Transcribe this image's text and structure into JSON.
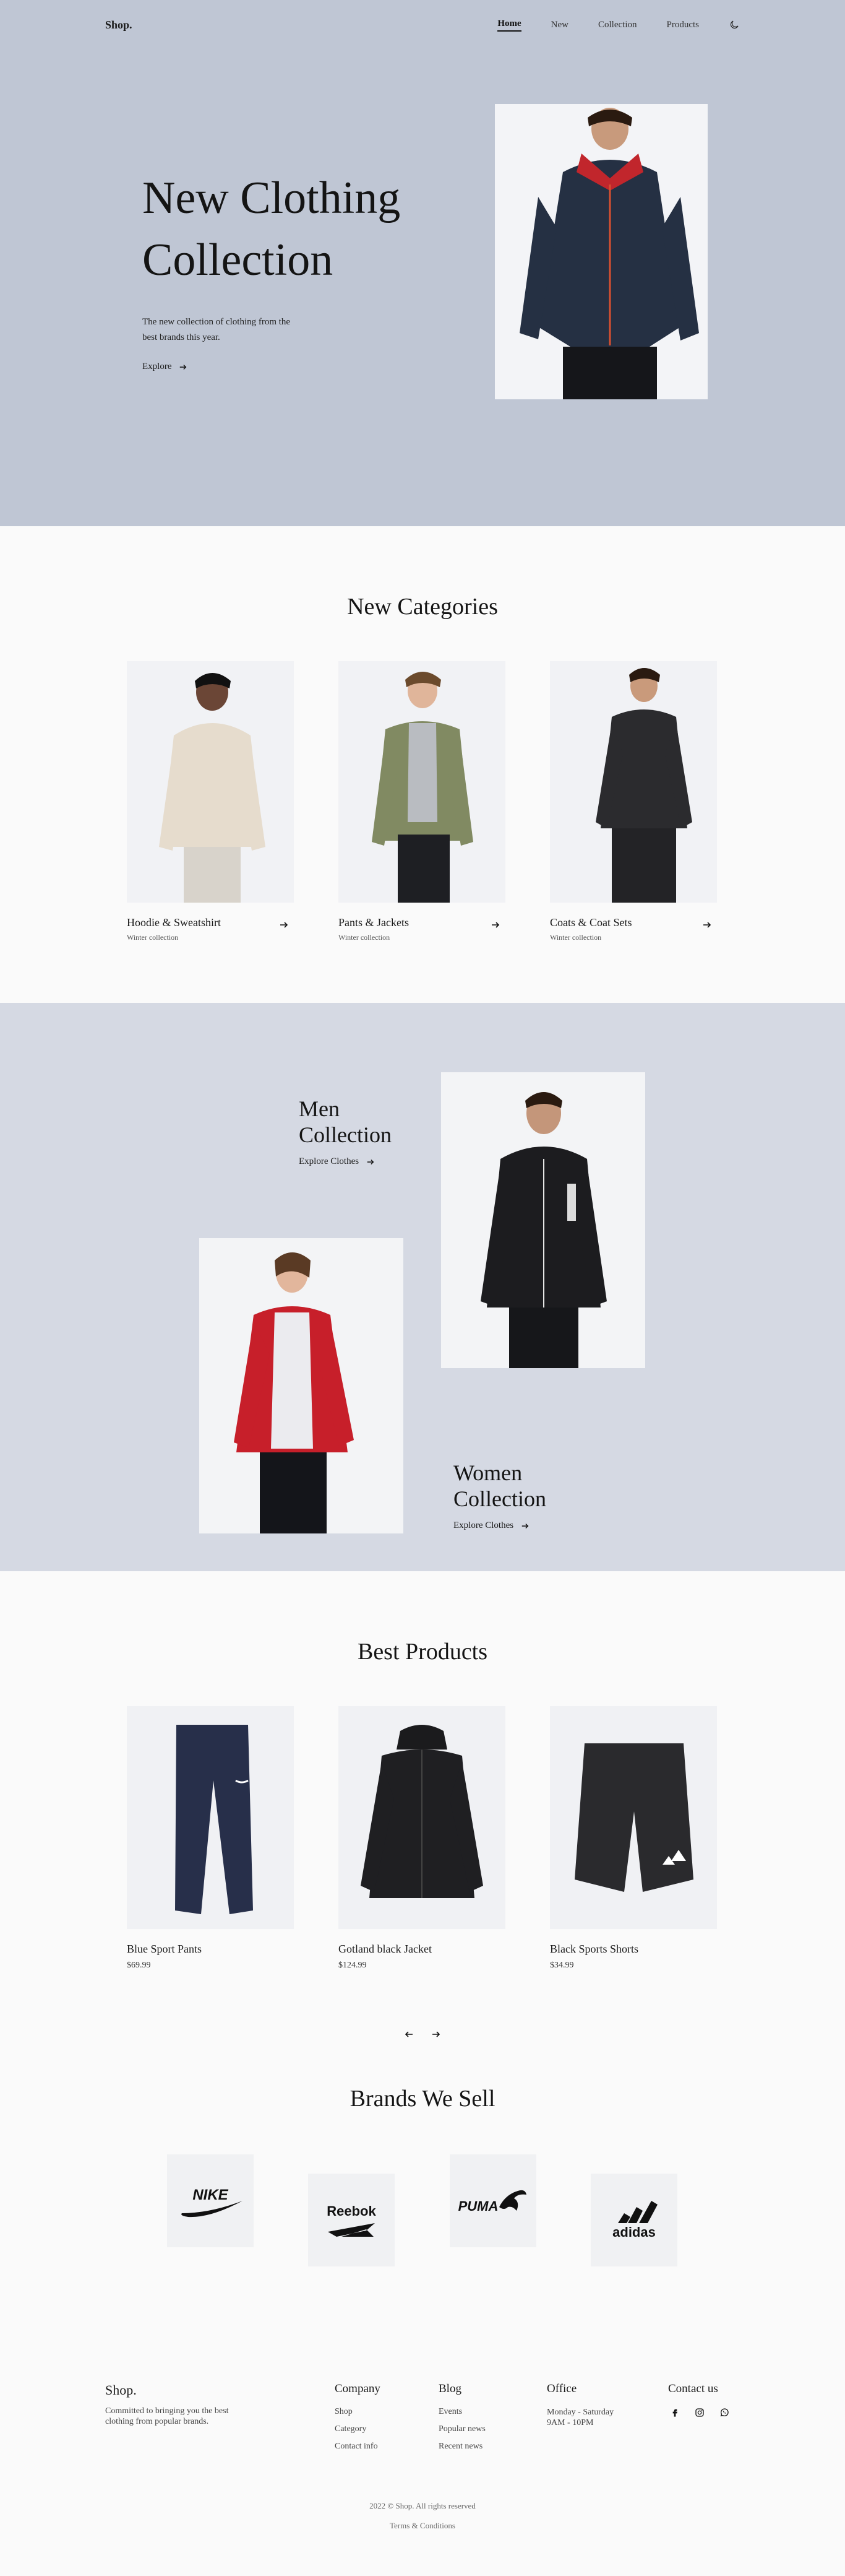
{
  "header": {
    "logo": "Shop.",
    "nav": [
      "Home",
      "New",
      "Collection",
      "Products"
    ],
    "theme_toggle_icon": "moon-icon"
  },
  "hero": {
    "title_line1": "New Clothing",
    "title_line2": "Collection",
    "description": "The new collection of clothing from the best brands this year.",
    "cta": "Explore",
    "cta_icon": "arrow-right-icon",
    "background": "#bfc6d4"
  },
  "categories": {
    "title": "New Categories",
    "items": [
      {
        "name": "Hoodie & Sweatshirt",
        "subtitle": "Winter collection"
      },
      {
        "name": "Pants & Jackets",
        "subtitle": "Winter collection"
      },
      {
        "name": "Coats & Coat Sets",
        "subtitle": "Winter collection"
      }
    ]
  },
  "collection": {
    "men_title_1": "Men",
    "men_title_2": "Collection",
    "men_cta": "Explore Clothes",
    "women_title_1": "Women",
    "women_title_2": "Collection",
    "women_cta": "Explore Clothes",
    "background": "#d5d9e3"
  },
  "products": {
    "title": "Best Products",
    "items": [
      {
        "name": "Blue Sport Pants",
        "price": "$69.99"
      },
      {
        "name": "Gotland black Jacket",
        "price": "$124.99"
      },
      {
        "name": "Black Sports Shorts",
        "price": "$34.99"
      }
    ],
    "prev_icon": "arrow-left-icon",
    "next_icon": "arrow-right-icon"
  },
  "brands": {
    "title": "Brands We Sell",
    "items": [
      "NIKE",
      "Reebok",
      "PUMA",
      "adidas"
    ]
  },
  "footer": {
    "logo": "Shop.",
    "tagline": "Committed to bringing you the best clothing from popular brands.",
    "company": {
      "title": "Company",
      "links": [
        "Shop",
        "Category",
        "Contact info"
      ]
    },
    "blog": {
      "title": "Blog",
      "links": [
        "Events",
        "Popular news",
        "Recent news"
      ]
    },
    "office": {
      "title": "Office",
      "hours_1": "Monday - Saturday",
      "hours_2": "9AM - 10PM"
    },
    "contact": {
      "title": "Contact us",
      "socials": [
        "facebook-icon",
        "instagram-icon",
        "whatsapp-icon"
      ]
    },
    "copyright": "2022 © Shop. All rights reserved",
    "terms": "Terms & Conditions"
  }
}
